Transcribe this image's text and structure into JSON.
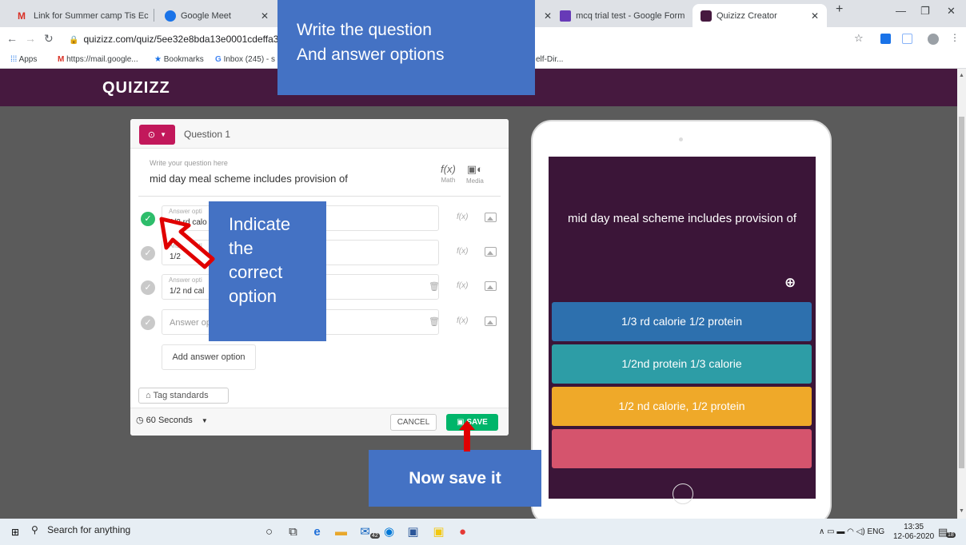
{
  "browser": {
    "tabs": [
      {
        "label": "Link for Summer camp Tis Ec",
        "icon": "gmail-icon"
      },
      {
        "label": "Google Meet",
        "icon": "meet-icon"
      },
      {
        "label": "mcq trial test - Google Form",
        "icon": "forms-icon"
      },
      {
        "label": "Quizizz Creator",
        "icon": "quizizz-icon"
      }
    ],
    "new_tab": "+",
    "url": "quizizz.com/quiz/5ee32e8bda13e0001cdeffa3/e",
    "bookmarks": [
      "Apps",
      "https://mail.google...",
      "Bookmarks",
      "Inbox (245) - s",
      "elf-Dir..."
    ]
  },
  "app": {
    "logo": "QUIZIZZ"
  },
  "editor": {
    "question_number": "Question 1",
    "question_placeholder": "Write your question here",
    "question_text": "mid day meal scheme includes provision of",
    "math_label": "Math",
    "media_label": "Media",
    "options": [
      {
        "placeholder": "Answer opti",
        "text": "1/3 rd calo",
        "correct": true
      },
      {
        "placeholder": "Answer opti",
        "text": "1/2",
        "correct": false
      },
      {
        "placeholder": "Answer opti",
        "text": "1/2 nd cal",
        "correct": false
      },
      {
        "placeholder": "",
        "text": "Answer op",
        "correct": false
      }
    ],
    "add_option": "Add answer option",
    "tag_standards": "Tag standards",
    "time": "60 Seconds",
    "cancel": "CANCEL",
    "save": "SAVE"
  },
  "preview": {
    "question": "mid day meal scheme includes provision of",
    "options": [
      {
        "text": "1/3 rd calorie 1/2 protein",
        "color": "#2d70ae"
      },
      {
        "text": "1/2nd protein 1/3 calorie",
        "color": "#2d9da6"
      },
      {
        "text": "1/2 nd calorie, 1/2 protein",
        "color": "#efa929"
      },
      {
        "text": "",
        "color": "#d5546d"
      }
    ]
  },
  "annotations": {
    "top_line1": "Write the question",
    "top_line2": "And answer options",
    "left": [
      "Indicate",
      "the",
      "correct",
      "option"
    ],
    "bottom": "Now save it"
  },
  "taskbar": {
    "search": "Search for anything",
    "badge": "42",
    "lang": "ENG",
    "time": "13:35",
    "date": "12-06-2020",
    "notifications": "18"
  }
}
